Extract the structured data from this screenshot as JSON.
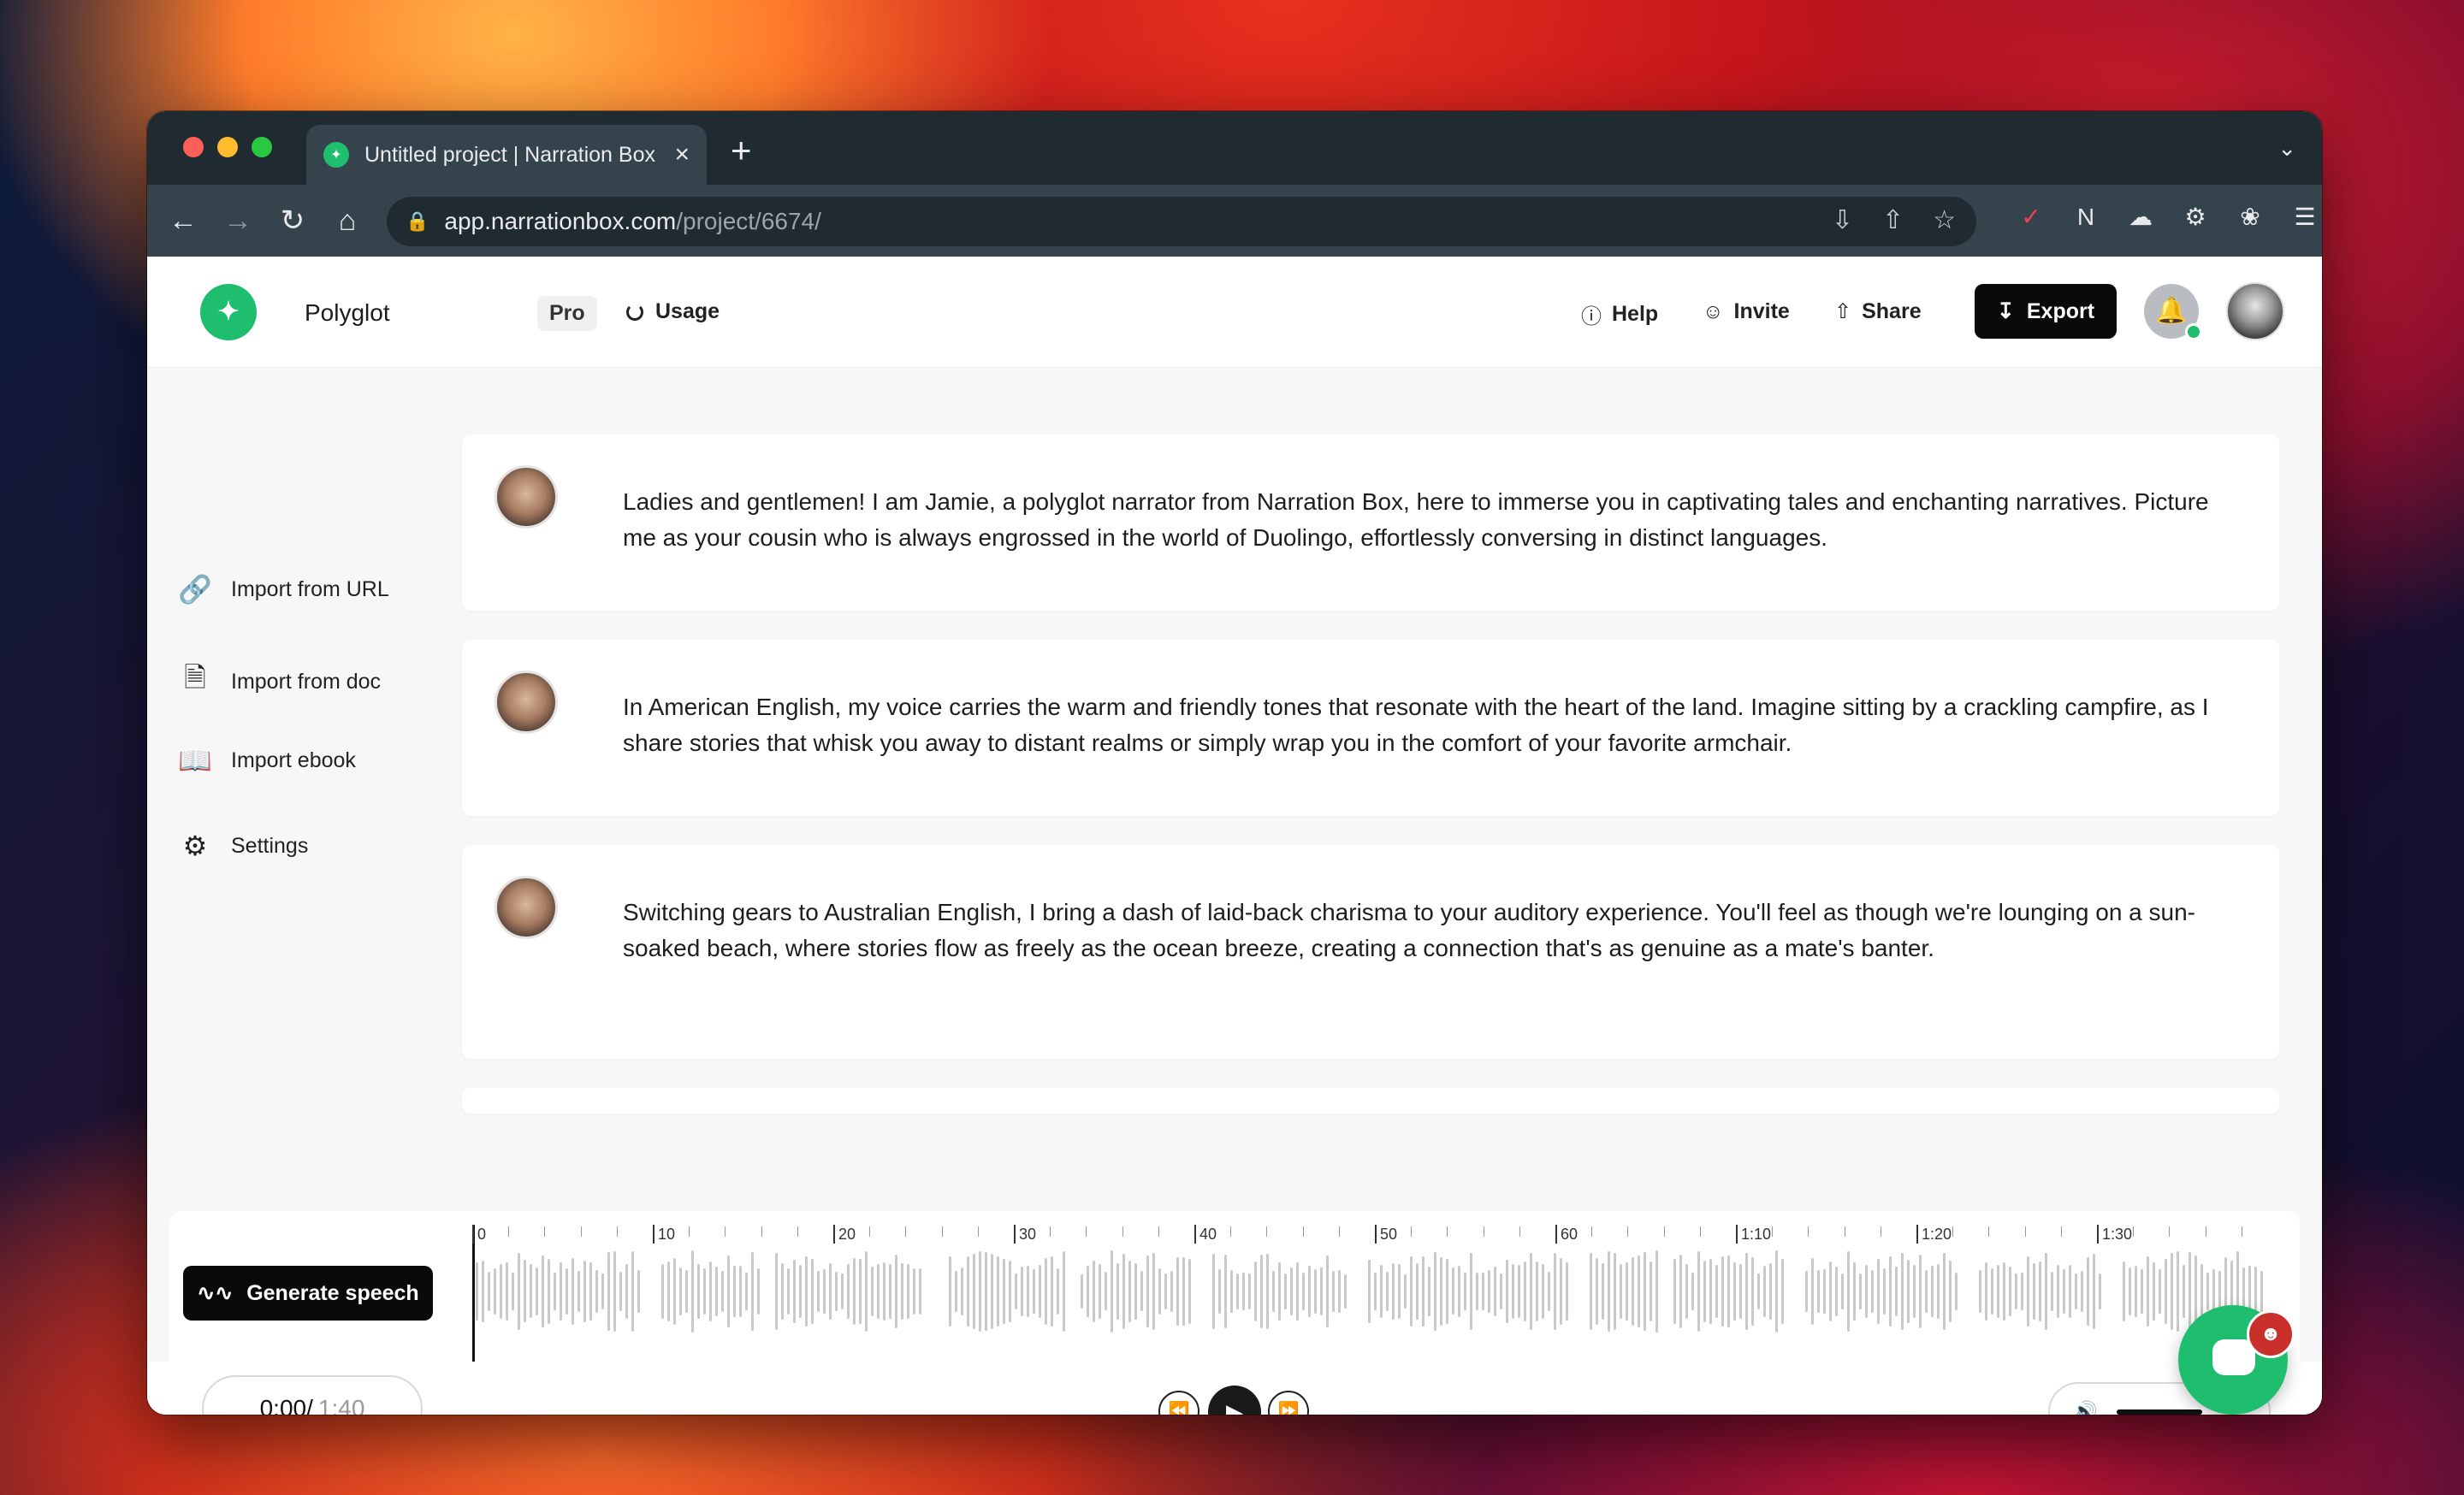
{
  "browser": {
    "tab_title": "Untitled project | Narration Box",
    "url_host": "app.narrationbox.com",
    "url_path": "/project/6674/"
  },
  "header": {
    "project_name": "Polyglot",
    "plan_badge": "Pro",
    "usage_label": "Usage",
    "help_label": "Help",
    "invite_label": "Invite",
    "share_label": "Share",
    "export_label": "Export"
  },
  "sidebar": {
    "items": [
      {
        "label": "Import from URL",
        "icon": "link-icon"
      },
      {
        "label": "Import from doc",
        "icon": "document-icon"
      },
      {
        "label": "Import ebook",
        "icon": "book-icon"
      },
      {
        "label": "Settings",
        "icon": "gear-icon"
      }
    ]
  },
  "blocks": [
    {
      "text": "Ladies and gentlemen! I am Jamie, a polyglot narrator from Narration Box, here to immerse you in captivating tales and enchanting narratives. Picture me as your cousin who is always engrossed in the world of Duolingo, effortlessly conversing in distinct languages."
    },
    {
      "text": "In American English, my voice carries the warm and friendly tones that resonate with the heart of the land. Imagine sitting by a crackling campfire, as I share stories that whisk you away to distant realms or simply wrap you in the comfort of your favorite armchair."
    },
    {
      "text": "Switching gears to Australian English, I bring a dash of laid-back charisma to your auditory experience. You'll feel as though we're lounging on a sun-soaked beach, where stories flow as freely as the ocean breeze, creating a connection that's as genuine as a mate's banter."
    }
  ],
  "timeline": {
    "generate_label": "Generate speech",
    "ruler_labels": [
      "0",
      "10",
      "20",
      "30",
      "40",
      "50",
      "60",
      "1:10",
      "1:20",
      "1:30"
    ]
  },
  "player": {
    "current_time": "0:00",
    "separator": " / ",
    "total_time": "1:40"
  },
  "colors": {
    "brand": "#1fbe6e",
    "dark_button": "#0a0a0a"
  }
}
